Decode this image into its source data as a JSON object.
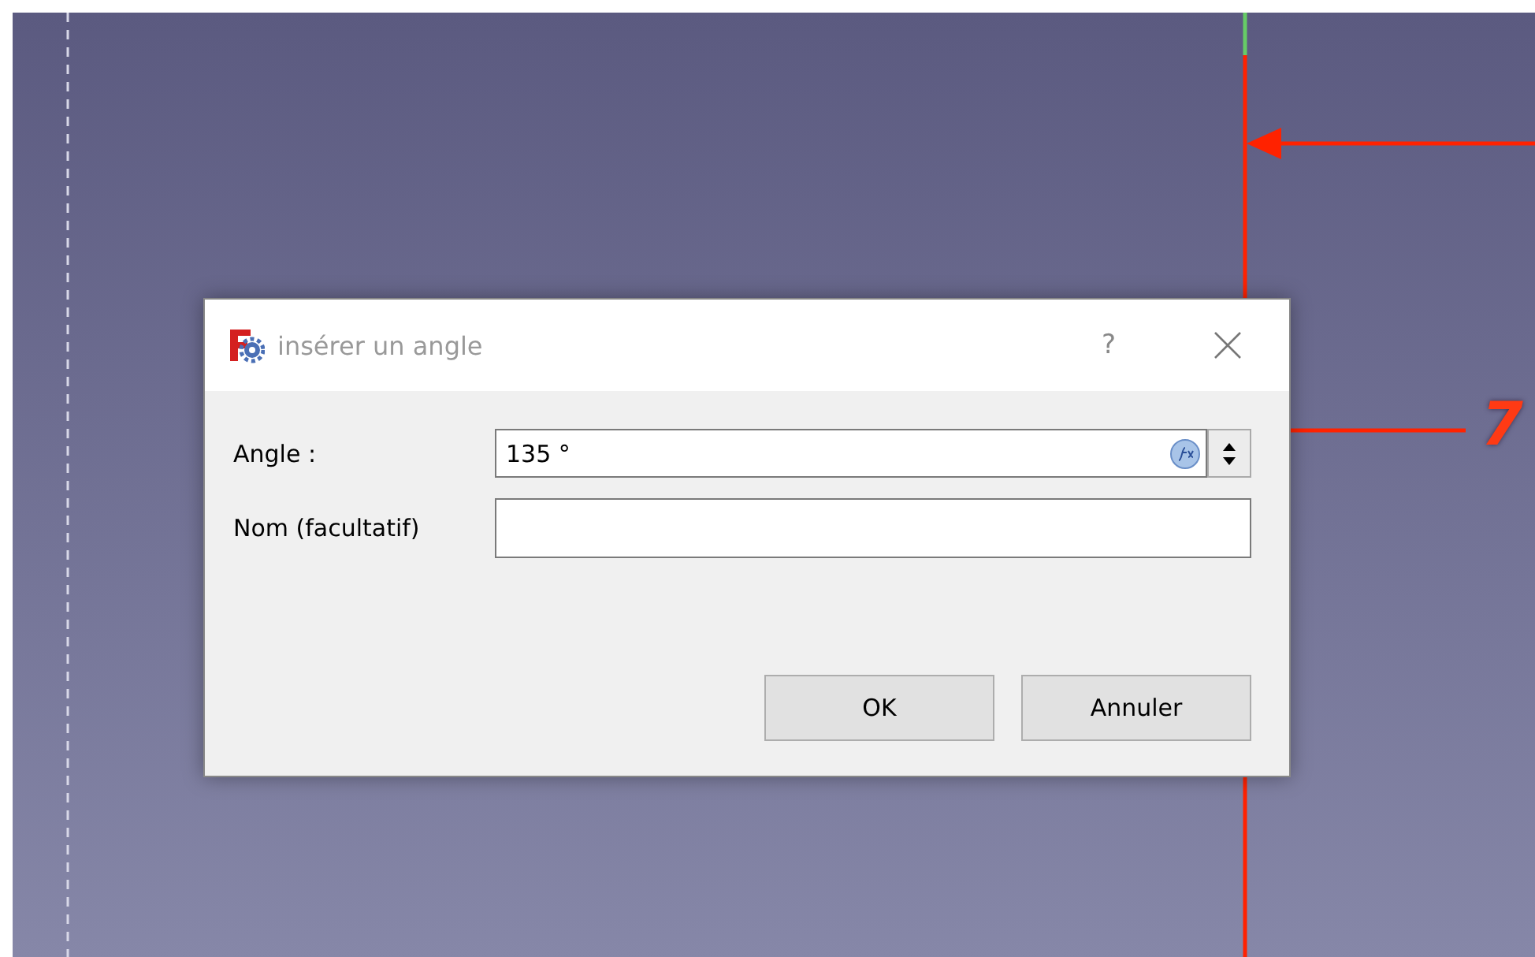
{
  "canvas": {
    "dimension_text": "7"
  },
  "dialog": {
    "title": "insérer un angle",
    "help": "?",
    "fields": [
      {
        "label": "Angle :",
        "value": "135 °",
        "kind": "spin"
      },
      {
        "label": "Nom (facultatif)",
        "kind": "text"
      }
    ],
    "buttons": [
      "OK",
      "Annuler"
    ]
  }
}
